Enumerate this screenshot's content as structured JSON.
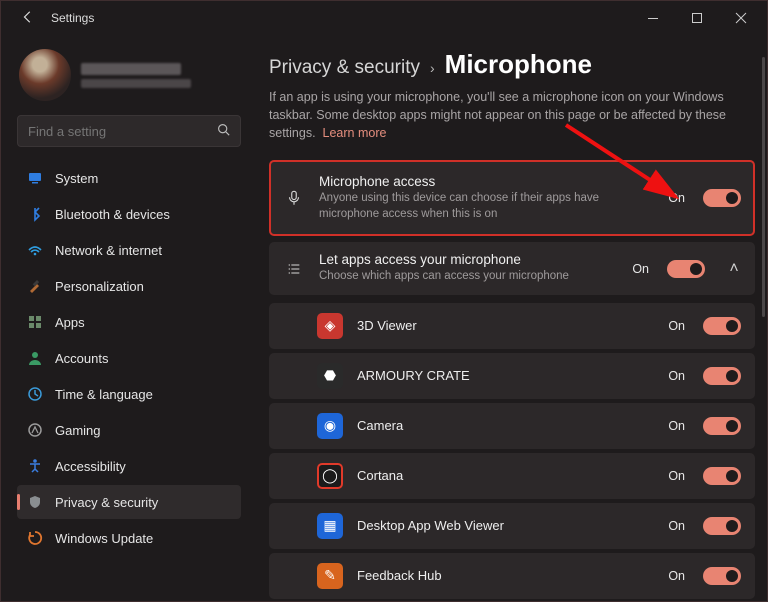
{
  "window": {
    "title": "Settings"
  },
  "search": {
    "placeholder": "Find a setting"
  },
  "sidebar": {
    "items": [
      {
        "label": "System",
        "icon": "system-icon",
        "color": "#2f7de0"
      },
      {
        "label": "Bluetooth & devices",
        "icon": "bluetooth-icon",
        "color": "#2f7de0"
      },
      {
        "label": "Network & internet",
        "icon": "wifi-icon",
        "color": "#2f9de0"
      },
      {
        "label": "Personalization",
        "icon": "brush-icon",
        "color": "#b06a35"
      },
      {
        "label": "Apps",
        "icon": "apps-icon",
        "color": "#6b8a6a"
      },
      {
        "label": "Accounts",
        "icon": "person-icon",
        "color": "#3a9a64"
      },
      {
        "label": "Time & language",
        "icon": "globe-clock-icon",
        "color": "#3a9ad8"
      },
      {
        "label": "Gaming",
        "icon": "gaming-icon",
        "color": "#8a8a8a"
      },
      {
        "label": "Accessibility",
        "icon": "accessibility-icon",
        "color": "#3a7de0"
      },
      {
        "label": "Privacy & security",
        "icon": "shield-icon",
        "color": "#8a8e91",
        "selected": true
      },
      {
        "label": "Windows Update",
        "icon": "update-icon",
        "color": "#e0762f"
      }
    ]
  },
  "page": {
    "breadcrumb_parent": "Privacy & security",
    "breadcrumb_current": "Microphone",
    "description": "If an app is using your microphone, you'll see a microphone icon on your Windows taskbar. Some desktop apps might not appear on this page or be affected by these settings.",
    "learn_more": "Learn more"
  },
  "settings": {
    "mic_access": {
      "title": "Microphone access",
      "subtitle": "Anyone using this device can choose if their apps have microphone access when this is on",
      "state_label": "On"
    },
    "let_apps": {
      "title": "Let apps access your microphone",
      "subtitle": "Choose which apps can access your microphone",
      "state_label": "On"
    }
  },
  "apps": [
    {
      "name": "3D Viewer",
      "state": "On",
      "bg": "#c9372f",
      "glyph": "◈"
    },
    {
      "name": "ARMOURY CRATE",
      "state": "On",
      "bg": "#2a2a2a",
      "glyph": "⬣"
    },
    {
      "name": "Camera",
      "state": "On",
      "bg": "#1e66d8",
      "glyph": "◉"
    },
    {
      "name": "Cortana",
      "state": "On",
      "bg": "#1b1b1b",
      "glyph": "◯",
      "ring": "#e03a2a"
    },
    {
      "name": "Desktop App Web Viewer",
      "state": "On",
      "bg": "#1e66d8",
      "glyph": "▦"
    },
    {
      "name": "Feedback Hub",
      "state": "On",
      "bg": "#d8641e",
      "glyph": "✎"
    }
  ]
}
